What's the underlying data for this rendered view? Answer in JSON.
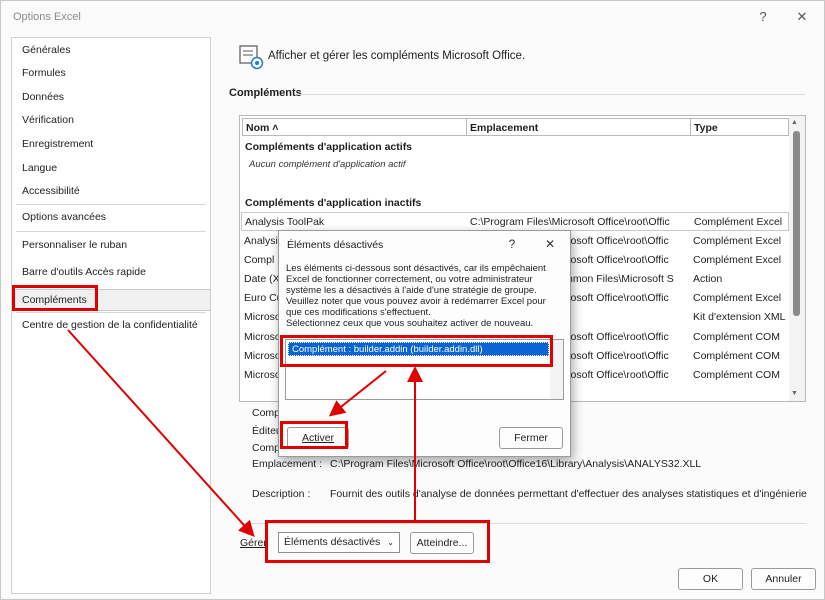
{
  "window": {
    "title": "Options Excel",
    "help_label": "?",
    "close_label": "✕"
  },
  "nav": {
    "items": [
      "Générales",
      "Formules",
      "Données",
      "Vérification",
      "Enregistrement",
      "Langue",
      "Accessibilité",
      "Options avancées",
      "Personnaliser le ruban",
      "Barre d'outils Accès rapide",
      "Compléments",
      "Centre de gestion de la confidentialité"
    ],
    "selected": "Compléments"
  },
  "header": {
    "icon": "addin-gear-icon",
    "text": "Afficher et gérer les compléments Microsoft Office."
  },
  "section_title": "Compléments",
  "table": {
    "columns": [
      "Nom ˄",
      "Emplacement",
      "Type"
    ],
    "active_group": "Compléments d'application actifs",
    "active_none": "Aucun complément d'application actif",
    "inactive_group": "Compléments d'application inactifs",
    "rows": [
      {
        "name": "Analysis ToolPak",
        "location": "C:\\Program Files\\Microsoft Office\\root\\Offic",
        "type": "Complément Excel"
      },
      {
        "name": "Analysis",
        "location": "C:\\Program Files\\Microsoft Office\\root\\Offic",
        "type": "Complément Excel"
      },
      {
        "name": "Compl",
        "location": "C:\\Program Files\\Microsoft Office\\root\\Offic",
        "type": "Complément Excel"
      },
      {
        "name": "Date (XI",
        "location": "C:\\Program Files\\Common Files\\Microsoft S",
        "type": "Action"
      },
      {
        "name": "Euro Cu",
        "location": "C:\\Program Files\\Microsoft Office\\root\\Offic",
        "type": "Complément Excel"
      },
      {
        "name": "Microso",
        "location": "",
        "type": "Kit d'extension XML"
      },
      {
        "name": "Microso",
        "location": "C:\\Program Files\\Microsoft Office\\root\\Offic",
        "type": "Complément COM"
      },
      {
        "name": "Microso",
        "location": "C:\\Program Files\\Microsoft Office\\root\\Offic",
        "type": "Complément COM"
      },
      {
        "name": "Microso",
        "location": "C:\\Program Files\\Microsoft Office\\root\\Offic",
        "type": "Complément COM"
      }
    ]
  },
  "details": {
    "label1": "Comp",
    "label2": "Éditeu",
    "label3": "Comp",
    "location_label": "Emplacement :",
    "location_value": "C:\\Program Files\\Microsoft Office\\root\\Office16\\Library\\Analysis\\ANALYS32.XLL",
    "description_label": "Description :",
    "description_value": "Fournit des outils d'analyse de données permettant d'effectuer des analyses statistiques et d'ingénierie"
  },
  "manage": {
    "label": "Gérer",
    "combo_value": "Éléments désactivés",
    "go_button": "Atteindre..."
  },
  "footer": {
    "ok": "OK",
    "cancel": "Annuler"
  },
  "dialog": {
    "title": "Éléments désactivés",
    "help": "?",
    "close": "✕",
    "message_lines": [
      "Les éléments ci-dessous sont désactivés, car ils empêchaient",
      "Excel de fonctionner correctement, ou votre administrateur",
      "système les a désactivés à l'aide d'une stratégie de groupe.",
      "Veuillez noter que vous pouvez avoir à redémarrer Excel pour",
      "que ces modifications s'effectuent.",
      "Sélectionnez ceux que vous souhaitez activer de nouveau."
    ],
    "item": "Complément : builder.addin (builder.addin.dll)",
    "activate": "Activer",
    "close_button": "Fermer"
  },
  "colors": {
    "highlight": "#e00000",
    "selection": "#0a64d3"
  }
}
